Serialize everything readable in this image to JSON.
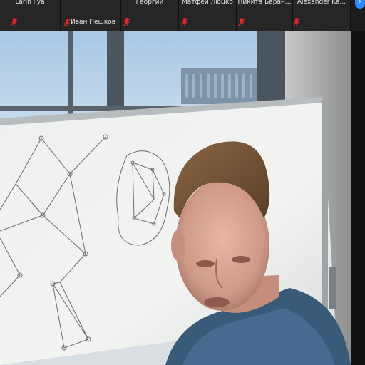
{
  "participants": [
    {
      "name": "Larin Ilya"
    },
    {
      "name": "Иван Пешков",
      "active": true
    },
    {
      "name": "Георгий"
    },
    {
      "name": "Матфей Люцко"
    },
    {
      "name": "Никита Баран..."
    },
    {
      "name": "Alexander Ka..."
    }
  ],
  "icons": {
    "muted_mic": "muted-mic-icon",
    "scroll": "chevron-right-icon"
  },
  "colors": {
    "mute_red": "#e02828",
    "accent_blue": "#2d8cff",
    "strip_bg": "#1c1c1c"
  }
}
